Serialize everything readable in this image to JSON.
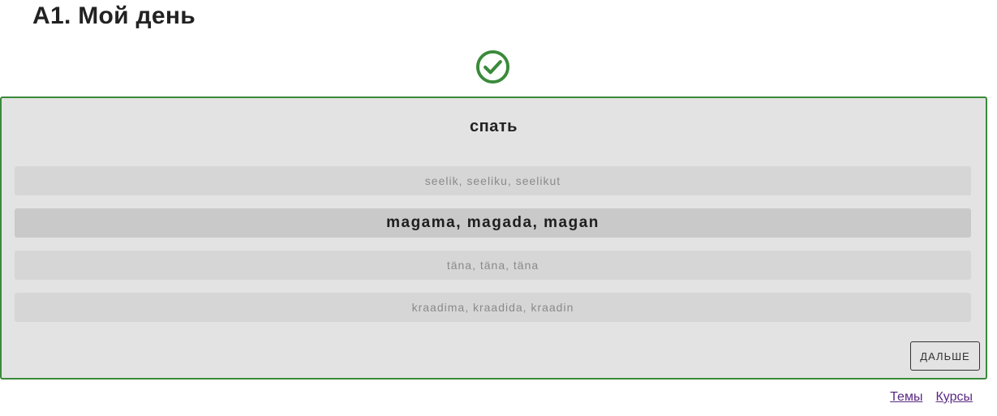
{
  "page": {
    "title": "A1. Мой день"
  },
  "status": {
    "icon": "check-circle-icon",
    "color": "#3a8a3a"
  },
  "quiz": {
    "question": "спать",
    "options": [
      {
        "label": "seelik, seeliku, seelikut",
        "selected": false
      },
      {
        "label": "magama, magada, magan",
        "selected": true
      },
      {
        "label": "täna, täna, täna",
        "selected": false
      },
      {
        "label": "kraadima, kraadida, kraadin",
        "selected": false
      }
    ],
    "next_label": "ДАЛЬШЕ"
  },
  "footer": {
    "links": [
      {
        "label": "Темы"
      },
      {
        "label": "Курсы"
      }
    ]
  },
  "colors": {
    "card_border": "#3a8a3a",
    "card_bg": "#e3e3e3",
    "link": "#5a2a82"
  }
}
